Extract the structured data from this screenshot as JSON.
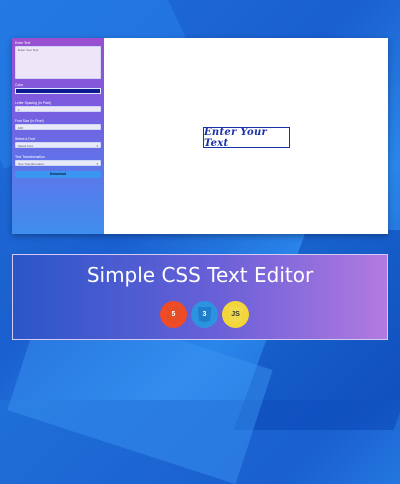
{
  "editor": {
    "enter_text_label": "Enter Text",
    "text_placeholder": "Enter Your Text",
    "color_label": "Color",
    "color_value": "#0c1a8f",
    "letter_spacing_label": "Letter Spacing (In Pixel)",
    "letter_spacing_value": "1",
    "font_size_label": "Font Size (In Pixel)",
    "font_size_value": "100",
    "font_label": "Select A Font",
    "font_value": "Select Font",
    "transform_label": "Text Transformation",
    "transform_value": "Text Transformation",
    "download_label": "Download"
  },
  "preview": {
    "text": "Enter Your Text"
  },
  "banner": {
    "title": "Simple CSS Text Editor",
    "icons": [
      {
        "name": "html5-icon",
        "glyph": "5"
      },
      {
        "name": "css3-icon",
        "glyph": "3"
      },
      {
        "name": "js-icon",
        "glyph": "JS"
      }
    ]
  },
  "colors": {
    "panel_gradient_top": "#9a4fd0",
    "panel_gradient_bottom": "#3f8eee",
    "preview_text": "#1a2fa8"
  }
}
